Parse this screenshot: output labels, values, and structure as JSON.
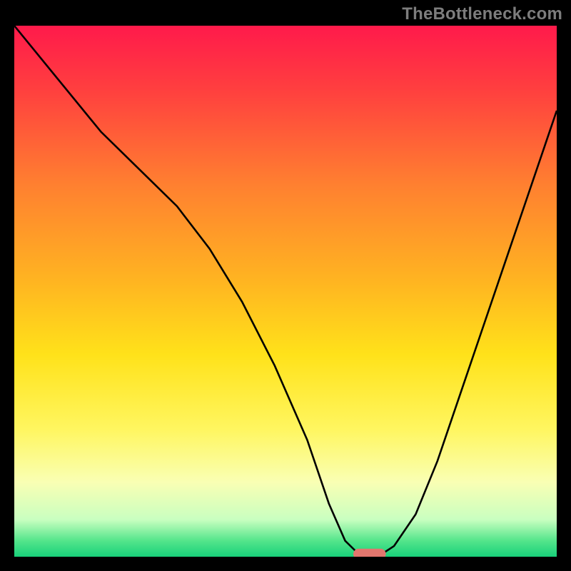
{
  "watermark": {
    "text": "TheBottleneck.com"
  },
  "chart_data": {
    "type": "line",
    "title": "",
    "xlabel": "",
    "ylabel": "",
    "xlim": [
      0,
      100
    ],
    "ylim": [
      0,
      100
    ],
    "background": {
      "type": "vertical-gradient",
      "stops": [
        {
          "pos": 0.0,
          "color": "#ff1a4b"
        },
        {
          "pos": 0.12,
          "color": "#ff3f3f"
        },
        {
          "pos": 0.3,
          "color": "#ff8030"
        },
        {
          "pos": 0.48,
          "color": "#ffb421"
        },
        {
          "pos": 0.62,
          "color": "#ffe21a"
        },
        {
          "pos": 0.76,
          "color": "#fff660"
        },
        {
          "pos": 0.86,
          "color": "#f9ffb4"
        },
        {
          "pos": 0.93,
          "color": "#c9ffc0"
        },
        {
          "pos": 0.97,
          "color": "#54e58b"
        },
        {
          "pos": 1.0,
          "color": "#18d07a"
        }
      ]
    },
    "series": [
      {
        "name": "bottleneck-curve",
        "color": "#000000",
        "x": [
          0,
          8,
          16,
          24,
          30,
          36,
          42,
          48,
          54,
          58,
          61,
          64,
          67,
          70,
          74,
          78,
          82,
          86,
          90,
          94,
          98,
          100
        ],
        "y": [
          100,
          90,
          80,
          72,
          66,
          58,
          48,
          36,
          22,
          10,
          3,
          0,
          0,
          2,
          8,
          18,
          30,
          42,
          54,
          66,
          78,
          84
        ]
      }
    ],
    "marker": {
      "name": "optimal-zone",
      "shape": "capsule",
      "color": "#e2766e",
      "x": 65.5,
      "y": 0.5,
      "width": 6,
      "height": 2
    }
  }
}
